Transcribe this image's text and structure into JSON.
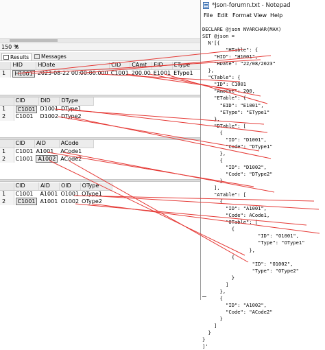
{
  "ssms": {
    "zoom": "150 %",
    "tabs": {
      "results": "Results",
      "messages": "Messages"
    },
    "grid1": {
      "headers": [
        "HID",
        "HDate",
        "CID",
        "CAmt",
        "EID",
        "EType"
      ],
      "rows": [
        {
          "num": "1",
          "HID": "H1001",
          "HDate": "2023-08-22 00:00:00.000",
          "CID": "C1001",
          "CAmt": "200.00",
          "EID": "E1001",
          "EType": "EType1"
        }
      ]
    },
    "grid2": {
      "headers": [
        "CID",
        "DID",
        "DType"
      ],
      "rows": [
        {
          "num": "1",
          "CID": "C1001",
          "DID": "D1001",
          "DType": "DType1"
        },
        {
          "num": "2",
          "CID": "C1001",
          "DID": "D1002",
          "DType": "DType2"
        }
      ]
    },
    "grid3": {
      "headers": [
        "CID",
        "AID",
        "ACode"
      ],
      "rows": [
        {
          "num": "1",
          "CID": "C1001",
          "AID": "A1001",
          "ACode": "ACode1"
        },
        {
          "num": "2",
          "CID": "C1001",
          "AID": "A1002",
          "ACode": "ACode2"
        }
      ]
    },
    "grid4": {
      "headers": [
        "CID",
        "AID",
        "OID",
        "OType"
      ],
      "rows": [
        {
          "num": "1",
          "CID": "C1001",
          "AID": "A1001",
          "OID": "O1001",
          "OType": "OType1"
        },
        {
          "num": "2",
          "CID": "C1001",
          "AID": "A1001",
          "OID": "O1002",
          "OType": "OType2"
        }
      ]
    }
  },
  "notepad": {
    "title": "*Json-forumn.txt - Notepad",
    "menu": [
      "File",
      "Edit",
      "Format",
      "View",
      "Help"
    ],
    "lines": [
      "DECLARE @json NVARCHAR(MAX)",
      "SET @json =",
      "  N'[{",
      "        \"HTable\": {",
      "    \"HID\": \"H1001\",",
      "    \"HDate\": \"22/08/2023\"",
      "  },",
      "  \"CTable\": {",
      "    \"ID\": C1001",
      "    \"Amount\": 200,",
      "    \"ETable\": {",
      "      \"EID\": \"E1001\",",
      "      \"EType\": \"EType1\"",
      "    },",
      "    \"DTable\": [",
      "      {",
      "        \"ID\": \"D1001\",",
      "        \"Code\": \"DType1\"",
      "      },",
      "      {",
      "        \"ID\": \"D1002\",",
      "        \"Code\": \"DType2\"",
      "      }",
      "    ],",
      "    \"ATable\": [",
      "      {",
      "        \"ID\": \"A1001\",",
      "        \"Code\": ACode1,",
      "        \"OTable\": [",
      "          {",
      "                   \"ID\": \"O1001\",",
      "                   \"Type\": \"OType1\"",
      "                },",
      "          {",
      "                 \"ID\": \"O1002\",",
      "                 \"Type\": \"OType2\"",
      "          }",
      "        ]",
      "      },",
      "      {",
      "        \"ID\": \"A1002\",",
      "        \"Code\": \"ACode2\"",
      "      }",
      "    ]",
      "  }",
      "}",
      "]'"
    ]
  },
  "colors": {
    "annotation": "#e53935",
    "grid_header": "#ececec",
    "separator": "#dcdcdc"
  }
}
